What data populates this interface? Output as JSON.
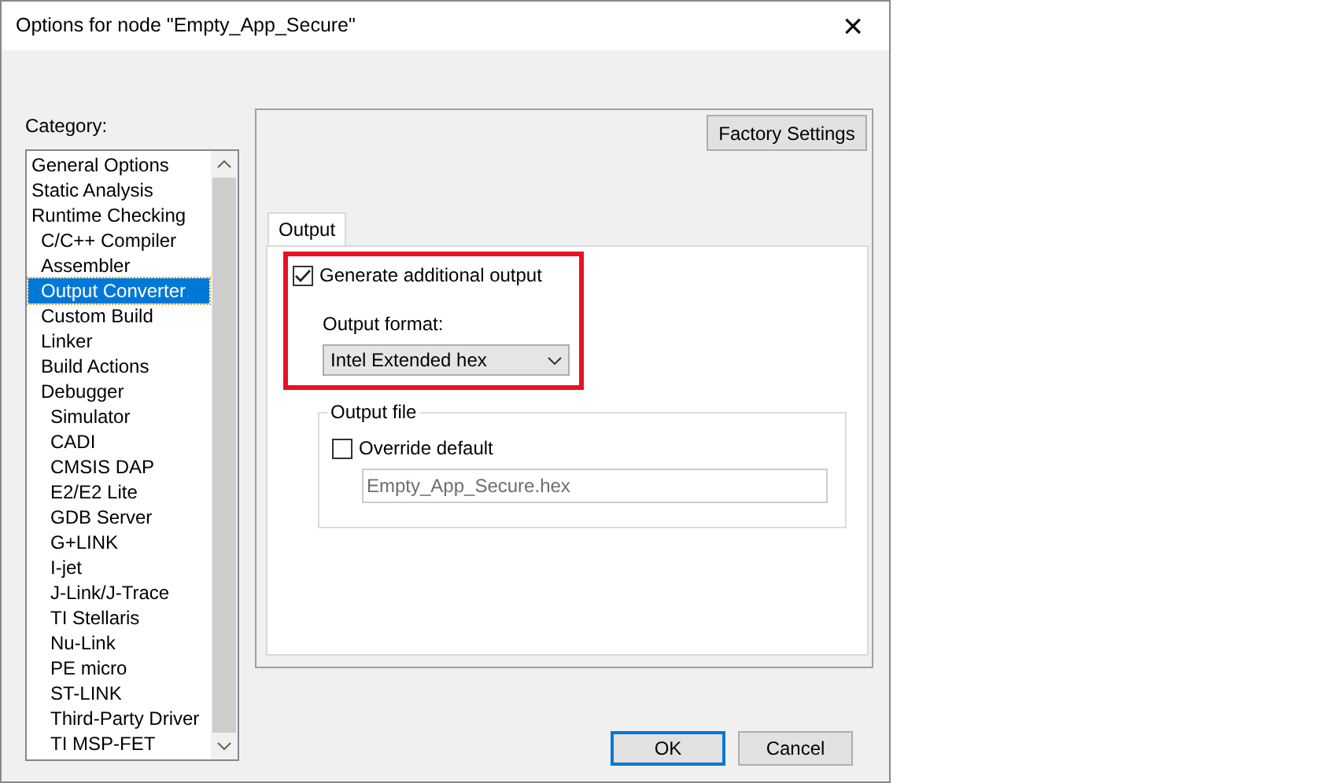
{
  "window": {
    "title": "Options for node \"Empty_App_Secure\"",
    "close": "×"
  },
  "category": {
    "label": "Category:",
    "items": [
      {
        "label": "General Options",
        "selected": false
      },
      {
        "label": "Static Analysis",
        "selected": false
      },
      {
        "label": "Runtime Checking",
        "selected": false,
        "children": [
          {
            "label": "C/C++ Compiler",
            "selected": false
          },
          {
            "label": "Assembler",
            "selected": false
          },
          {
            "label": "Output Converter",
            "selected": true
          },
          {
            "label": "Custom Build",
            "selected": false
          },
          {
            "label": "Linker",
            "selected": false
          },
          {
            "label": "Build Actions",
            "selected": false
          },
          {
            "label": "Debugger",
            "selected": false,
            "children": [
              {
                "label": "Simulator",
                "selected": false
              },
              {
                "label": "CADI",
                "selected": false
              },
              {
                "label": "CMSIS DAP",
                "selected": false
              },
              {
                "label": "E2/E2 Lite",
                "selected": false
              },
              {
                "label": "GDB Server",
                "selected": false
              },
              {
                "label": "G+LINK",
                "selected": false
              },
              {
                "label": "I-jet",
                "selected": false
              },
              {
                "label": "J-Link/J-Trace",
                "selected": false
              },
              {
                "label": "TI Stellaris",
                "selected": false
              },
              {
                "label": "Nu-Link",
                "selected": false
              },
              {
                "label": "PE micro",
                "selected": false
              },
              {
                "label": "ST-LINK",
                "selected": false
              },
              {
                "label": "Third-Party Driver",
                "selected": false
              },
              {
                "label": "TI MSP-FET",
                "selected": false
              }
            ]
          }
        ]
      }
    ]
  },
  "factory_button": "Factory Settings",
  "tabs": [
    {
      "label": "Output",
      "selected": true
    }
  ],
  "generate": {
    "label": "Generate additional output",
    "checked": true
  },
  "output_format": {
    "label": "Output format:",
    "value": "Intel Extended hex"
  },
  "output_file": {
    "legend": "Output file",
    "override": {
      "label": "Override default",
      "checked": false
    },
    "path": {
      "value": "Empty_App_Secure.hex",
      "disabled": true
    }
  },
  "buttons": [
    {
      "label": "OK",
      "default": true
    },
    {
      "label": "Cancel",
      "default": false
    }
  ]
}
